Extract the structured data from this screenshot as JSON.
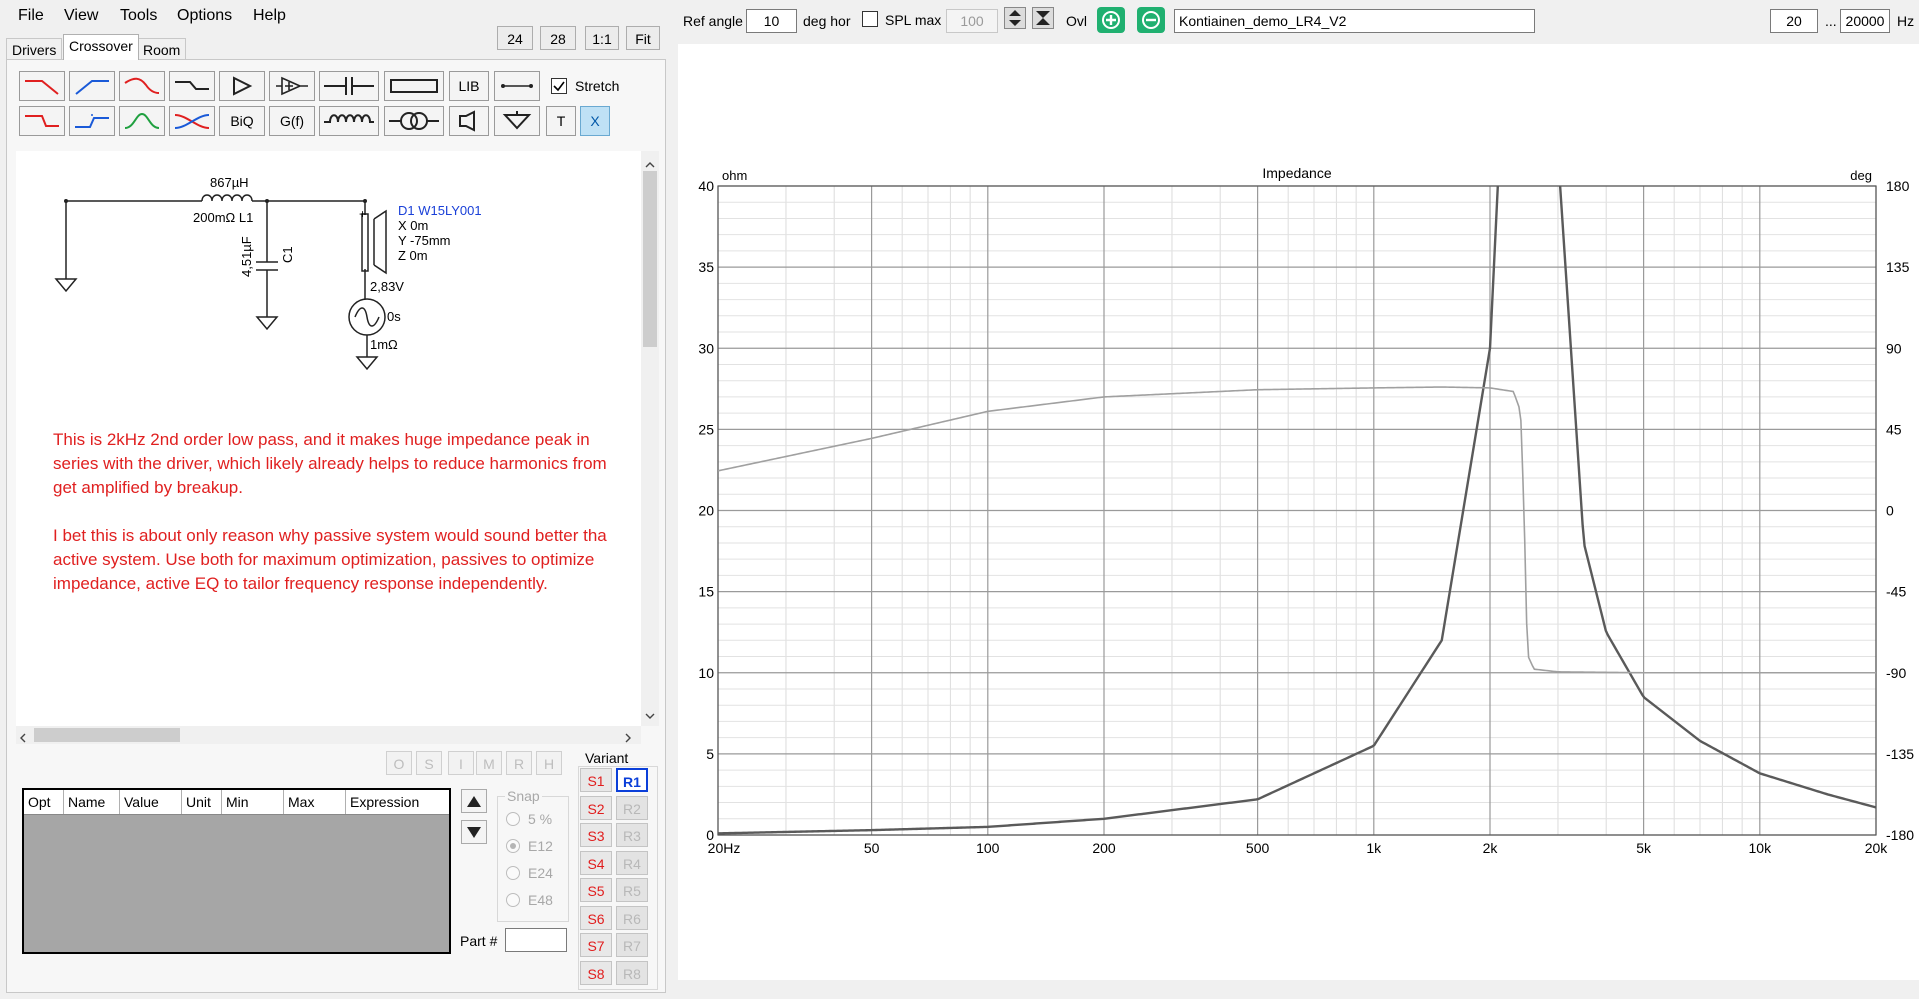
{
  "menu": [
    "File",
    "View",
    "Tools",
    "Options",
    "Help"
  ],
  "tabs": [
    "Drivers",
    "Crossover",
    "Room"
  ],
  "view_buttons": [
    "24",
    "28",
    "1:1",
    "Fit"
  ],
  "toolbar": {
    "lib_label": "LIB",
    "biq_label": "BiQ",
    "gf_label": "G(f)",
    "t_label": "T",
    "x_label": "X",
    "stretch_label": "Stretch",
    "stretch_checked": true
  },
  "schematic": {
    "inductor_value": "867µH",
    "inductor_name": "200mΩ L1",
    "cap_value": "4,51µF",
    "cap_name": "C1",
    "driver_name": "D1 W15LY001",
    "driver_x": "X 0m",
    "driver_y": "Y -75mm",
    "driver_z": "Z 0m",
    "source_voltage": "2,83V",
    "source_delay": "0s",
    "source_resistance": "1mΩ",
    "plus": "+"
  },
  "notes": [
    "This is 2kHz 2nd order low pass, and it makes huge impedance peak in",
    "series with the driver, which likely already helps to reduce harmonics from",
    "get amplified by breakup.",
    "",
    "I bet this is about only reason why passive system would sound better tha",
    "active system. Use both for maximum optimization, passives to optimize",
    "impedance, active EQ to tailor frequency response independently."
  ],
  "opt_buttons": [
    "O",
    "S",
    "I",
    "M",
    "R",
    "H"
  ],
  "param_table": {
    "columns": [
      "Opt",
      "Name",
      "Value",
      "Unit",
      "Min",
      "Max",
      "Expression"
    ]
  },
  "snap": {
    "label": "Snap",
    "options": [
      "5 %",
      "E12",
      "E24",
      "E48"
    ],
    "selected": "E12"
  },
  "part_label": "Part #",
  "variant": {
    "label": "Variant",
    "s": [
      "S1",
      "S2",
      "S3",
      "S4",
      "S5",
      "S6",
      "S7",
      "S8"
    ],
    "r": [
      "R1",
      "R2",
      "R3",
      "R4",
      "R5",
      "R6",
      "R7",
      "R8"
    ],
    "selected": "R1"
  },
  "top_controls": {
    "ref_angle_label": "Ref angle",
    "ref_angle_value": "10",
    "deg_hor_label": "deg hor",
    "spl_max_label": "SPL max",
    "spl_max_value": "100",
    "ovl_label": "Ovl",
    "project_name": "Kontiainen_demo_LR4_V2",
    "freq_min": "20",
    "range_sep": "...",
    "freq_max": "20000",
    "hz_label": "Hz"
  },
  "chart_data": {
    "type": "line",
    "title": "Impedance",
    "y_unit_left": "ohm",
    "y_unit_right": "deg",
    "x_scale": "log",
    "xlim": [
      20,
      20000
    ],
    "ylim": [
      0,
      40
    ],
    "y2lim": [
      -180,
      180
    ],
    "x_ticks": [
      20,
      50,
      100,
      200,
      500,
      1000,
      2000,
      5000,
      10000,
      20000
    ],
    "x_tick_labels": [
      "20Hz",
      "50",
      "100",
      "200",
      "500",
      "1k",
      "2k",
      "5k",
      "10k",
      "20k"
    ],
    "y_ticks": [
      0,
      5,
      10,
      15,
      20,
      25,
      30,
      35,
      40
    ],
    "y2_ticks": [
      -180,
      -135,
      -90,
      -45,
      0,
      45,
      90,
      135,
      180
    ],
    "grid": true,
    "series": [
      {
        "axis": "left",
        "color": "#5a5a5a",
        "x": [
          20,
          50,
          100,
          200,
          500,
          1000,
          1500,
          2000,
          2300,
          2500,
          2600,
          2700,
          2800,
          3000,
          3500,
          4000,
          5000,
          7000,
          10000,
          15000,
          20000
        ],
        "y": [
          0.1,
          0.3,
          0.5,
          1.0,
          2.2,
          5.5,
          12,
          30,
          60,
          100,
          100,
          100,
          70,
          42,
          18,
          12.5,
          8.5,
          5.8,
          3.8,
          2.5,
          1.7
        ]
      },
      {
        "axis": "right",
        "color": "#a0a0a0",
        "x": [
          20,
          50,
          100,
          200,
          500,
          1000,
          1500,
          2000,
          2300,
          2400,
          2450,
          2500,
          2600,
          3000,
          5000,
          10000,
          20000
        ],
        "y": [
          22,
          40,
          55,
          63,
          67,
          68,
          68.5,
          68,
          66,
          55,
          0,
          -80,
          -88,
          -89.5,
          -90,
          -90,
          -90
        ]
      }
    ]
  }
}
